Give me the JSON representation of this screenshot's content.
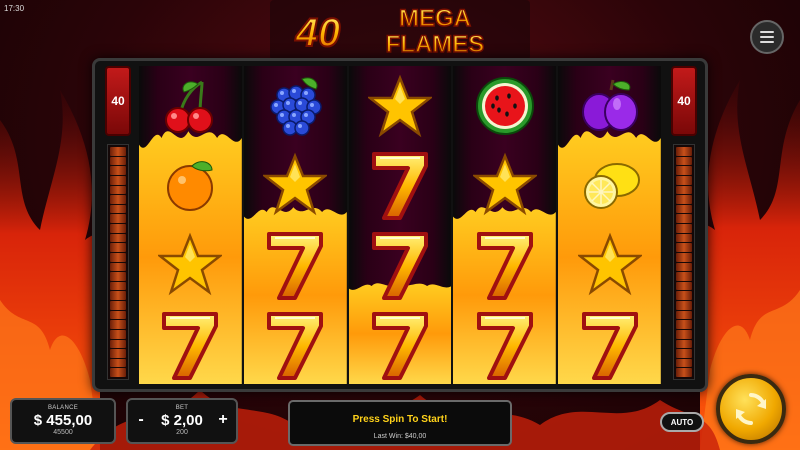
{
  "status_bar": {
    "time": "17:30"
  },
  "game": {
    "title_number": "40",
    "title_line1": "MEGA",
    "title_line2": "FLAMES"
  },
  "lines": {
    "left": "40",
    "right": "40"
  },
  "reels": [
    [
      "cherries",
      "orange",
      "star",
      "seven"
    ],
    [
      "grapes",
      "star",
      "seven",
      "seven"
    ],
    [
      "star",
      "seven",
      "seven",
      "seven"
    ],
    [
      "watermelon",
      "star",
      "seven",
      "seven"
    ],
    [
      "plum",
      "lemon",
      "star",
      "seven"
    ]
  ],
  "burning_rows": [
    3,
    2,
    1,
    2,
    3
  ],
  "balance": {
    "label": "BALANCE",
    "value": "$ 455,00",
    "credits": "45500"
  },
  "bet": {
    "label": "BET",
    "minus": "-",
    "value": "$ 2,00",
    "plus": "+",
    "credits": "200"
  },
  "message": {
    "text": "Press Spin To Start!",
    "last_win": "Last Win: $40,00"
  },
  "controls": {
    "auto_label": "AUTO"
  },
  "icons": {
    "menu": "hamburger-menu-icon",
    "spin": "spin-arrows-icon"
  },
  "colors": {
    "accent": "#f0a800",
    "message": "#ffd21a",
    "lines_badge": "#c21a1a"
  }
}
